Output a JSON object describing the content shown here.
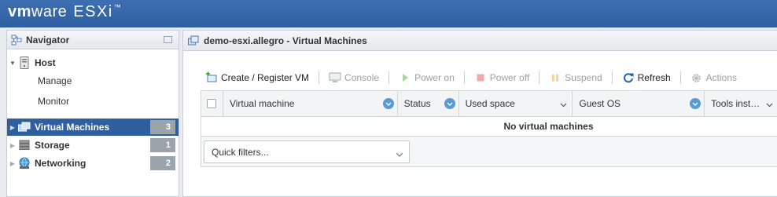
{
  "brand": {
    "vm": "vm",
    "ware": "ware",
    "product": "ESXi",
    "tm": "™"
  },
  "navigator": {
    "title": "Navigator",
    "items": [
      {
        "label": "Host",
        "expanded": true
      },
      {
        "label": "Manage"
      },
      {
        "label": "Monitor"
      },
      {
        "label": "Virtual Machines",
        "count": "3",
        "selected": true
      },
      {
        "label": "Storage",
        "count": "1"
      },
      {
        "label": "Networking",
        "count": "2"
      }
    ]
  },
  "main": {
    "title": "demo-esxi.allegro - Virtual Machines",
    "toolbar": {
      "create": "Create / Register VM",
      "console": "Console",
      "power_on": "Power on",
      "power_off": "Power off",
      "suspend": "Suspend",
      "refresh": "Refresh",
      "actions": "Actions"
    },
    "columns": [
      "Virtual machine",
      "Status",
      "Used space",
      "Guest OS",
      "Tools inst…"
    ],
    "empty_message": "No virtual machines",
    "quick_filter_placeholder": "Quick filters..."
  },
  "colors": {
    "banner": "#2f5f9f",
    "selected": "#2f5f9f",
    "sort_badge": "#5b9bd5",
    "count_badge": "#9ba3ab"
  }
}
